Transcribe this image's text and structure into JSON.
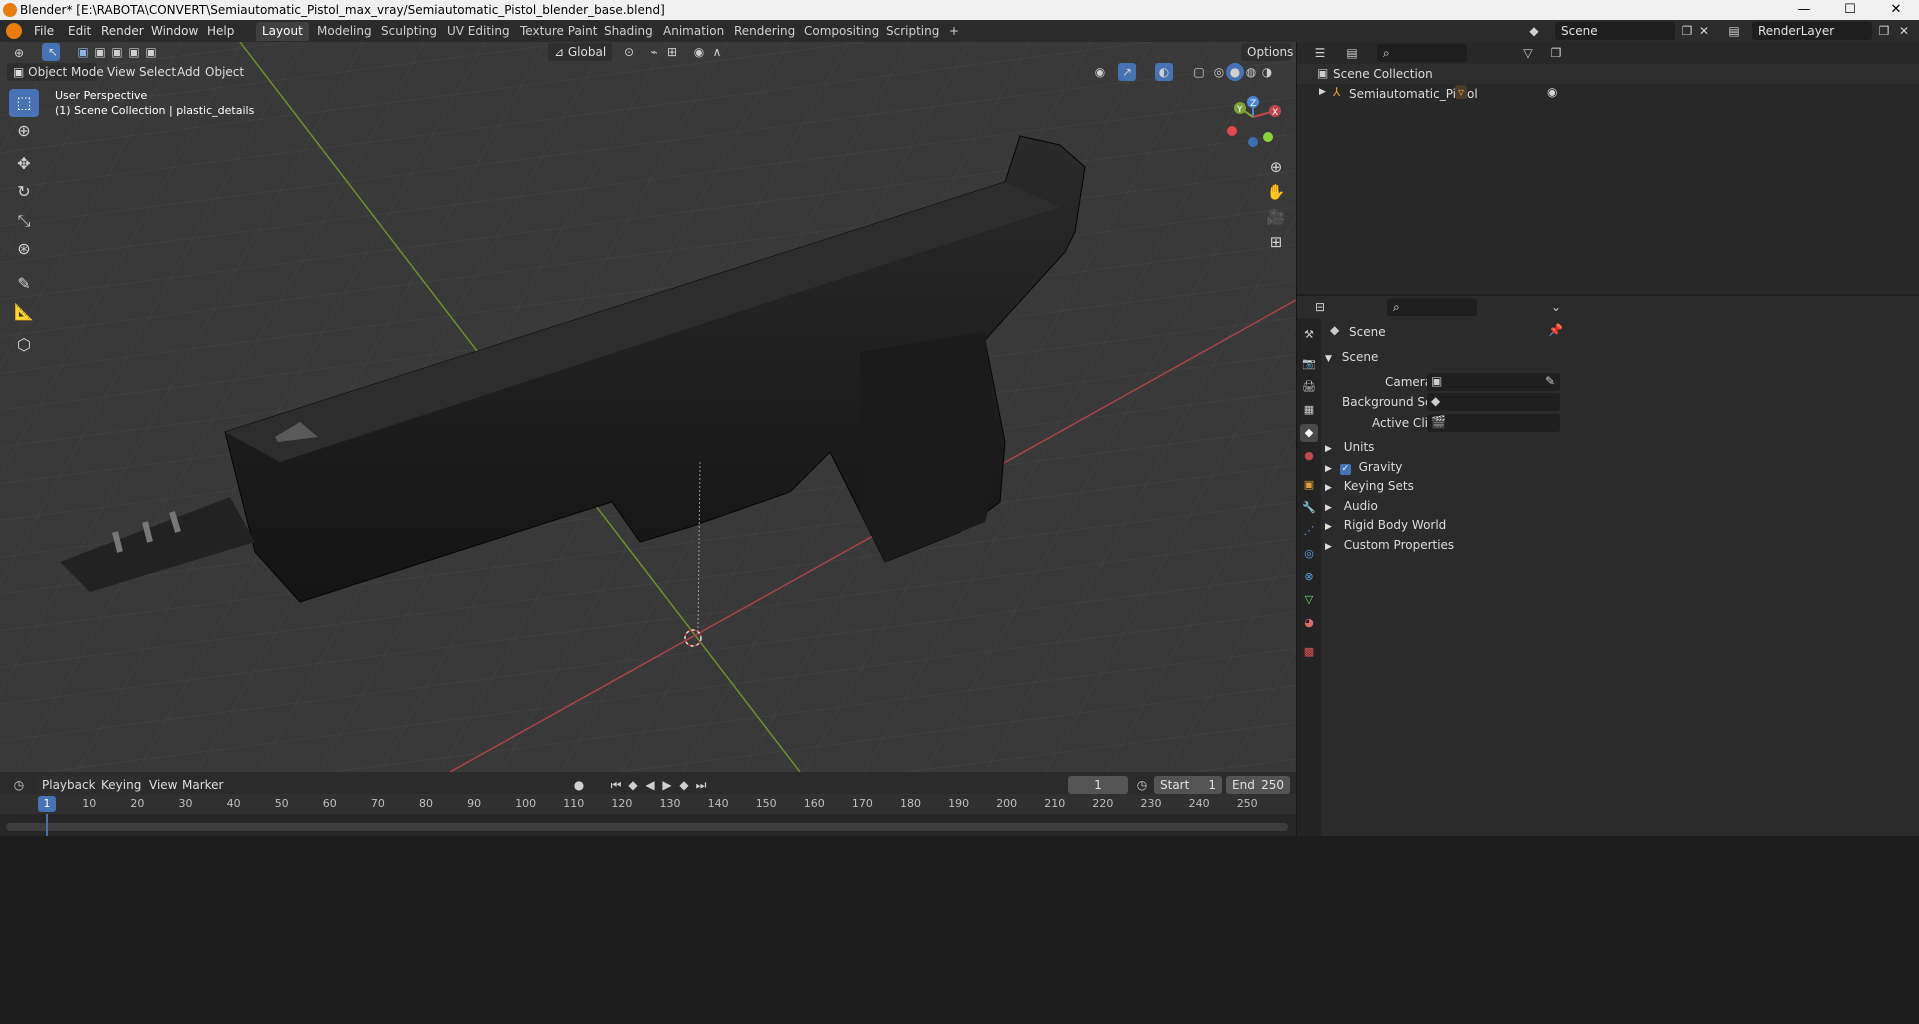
{
  "window": {
    "title": "Blender* [E:\\RABOTA\\CONVERT\\Semiautomatic_Pistol_max_vray/Semiautomatic_Pistol_blender_base.blend]",
    "minimize": "—",
    "maximize": "☐",
    "close": "✕"
  },
  "menu": {
    "items": [
      "File",
      "Edit",
      "Render",
      "Window",
      "Help"
    ]
  },
  "workspaces": {
    "tabs": [
      "Layout",
      "Modeling",
      "Sculpting",
      "UV Editing",
      "Texture Paint",
      "Shading",
      "Animation",
      "Rendering",
      "Compositing",
      "Scripting"
    ],
    "add": "+",
    "active": "Layout"
  },
  "scene_selector": {
    "value": "Scene"
  },
  "renderlayer_selector": {
    "value": "RenderLayer"
  },
  "viewport": {
    "mode": "Object Mode",
    "menus": [
      "View",
      "Select",
      "Add",
      "Object"
    ],
    "transform_orientation": "Global",
    "options_label": "Options",
    "overlay_line1": "User Perspective",
    "overlay_line2": "(1) Scene Collection | plastic_details",
    "gizmo": {
      "x": "X",
      "y": "Y",
      "z": "Z"
    }
  },
  "outliner": {
    "root": "Scene Collection",
    "items": [
      {
        "label": "Semiautomatic_Pistol"
      }
    ]
  },
  "properties": {
    "context_title": "Scene",
    "section_scene": "Scene",
    "camera_label": "Camera",
    "background_scene_label": "Background Scene",
    "active_clip_label": "Active Clip",
    "panels": [
      "Units",
      "Gravity",
      "Keying Sets",
      "Audio",
      "Rigid Body World",
      "Custom Properties"
    ],
    "gravity_checked": true
  },
  "timeline": {
    "menus": [
      "Playback",
      "Keying",
      "View",
      "Marker"
    ],
    "current_frame": "1",
    "start_label": "Start",
    "start_value": "1",
    "end_label": "End",
    "end_value": "250",
    "ticks": [
      "1",
      "10",
      "20",
      "30",
      "40",
      "50",
      "60",
      "70",
      "80",
      "90",
      "100",
      "110",
      "120",
      "130",
      "140",
      "150",
      "160",
      "170",
      "180",
      "190",
      "200",
      "210",
      "220",
      "230",
      "240",
      "250"
    ]
  },
  "colors": {
    "accent": "#4772b3",
    "x_axis": "#c0464a",
    "y_axis": "#7ca33a",
    "z_axis": "#4a88d6",
    "viewport_bg": "#393939"
  }
}
